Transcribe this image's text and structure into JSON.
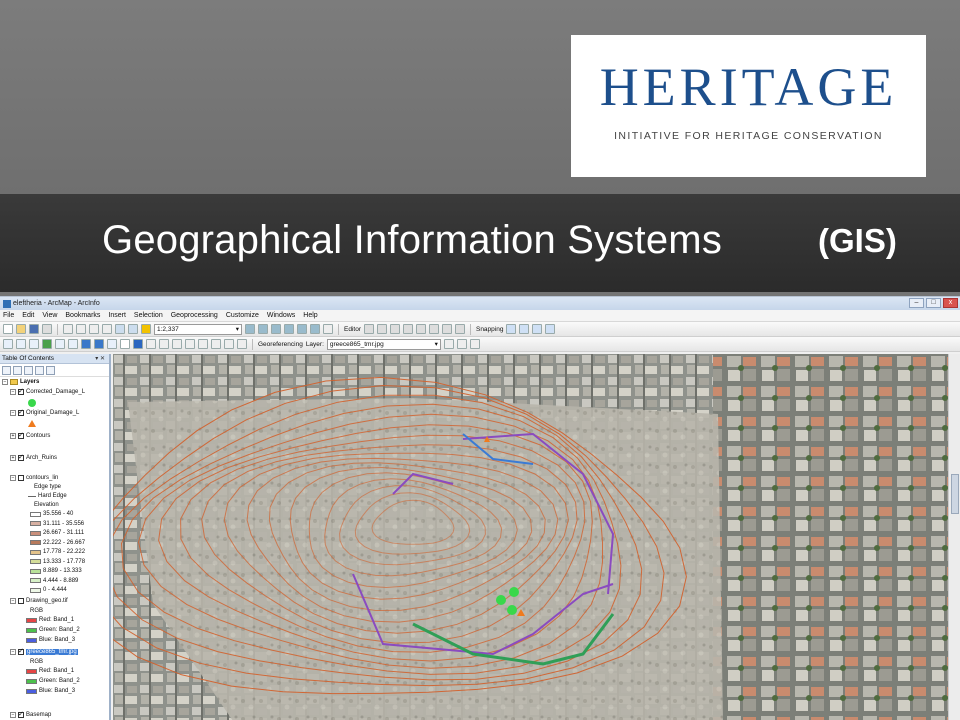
{
  "logo": {
    "wordmark": "HERITAGE",
    "tagline": "INITIATIVE FOR HERITAGE CONSERVATION",
    "color": "#1d4f8c"
  },
  "slide": {
    "title": "Geographical Information Systems",
    "title_abbr": "(GIS)"
  },
  "app": {
    "window_title": "eleftheria - ArcMap - ArcInfo",
    "menu": [
      "File",
      "Edit",
      "View",
      "Bookmarks",
      "Insert",
      "Selection",
      "Geoprocessing",
      "Customize",
      "Windows",
      "Help"
    ],
    "scale": "1:2,337",
    "editor_label": "Editor",
    "snapping_label": "Snapping",
    "georef_label": "Georeferencing",
    "layer_label": "Layer:",
    "layer_value": "greece865_tmr.jpg",
    "window_controls": [
      "–",
      "□",
      "x"
    ]
  },
  "toc": {
    "title": "Table Of Contents",
    "head_controls": "▾ ✕",
    "root": "Layers",
    "layers": [
      {
        "name": "Corrected_Damage_L",
        "checked": true
      },
      {
        "name": "Original_Damage_L",
        "checked": true
      },
      {
        "name": "Contours",
        "checked": true
      },
      {
        "name": "Arch_Ruins",
        "checked": true
      },
      {
        "name": "contours_lin",
        "checked": false
      }
    ],
    "contour_legend": {
      "edge_type": "Edge type",
      "hard_edge": "Hard Edge",
      "elevation": "Elevation",
      "classes": [
        {
          "label": "35.556 - 40",
          "color": "#ffffff"
        },
        {
          "label": "31.111 - 35.556",
          "color": "#d7b0a2"
        },
        {
          "label": "26.667 - 31.111",
          "color": "#c98f7b"
        },
        {
          "label": "22.222 - 26.667",
          "color": "#b77a5c"
        },
        {
          "label": "17.778 - 22.222",
          "color": "#e3c28a"
        },
        {
          "label": "13.333 - 17.778",
          "color": "#d4dd9a"
        },
        {
          "label": "8.889 - 13.333",
          "color": "#b9e29a"
        },
        {
          "label": "4.444 - 8.889",
          "color": "#d7f1c7"
        },
        {
          "label": "0 - 4.444",
          "color": "#eef8e7"
        }
      ]
    },
    "raster1": {
      "name": "Drawing_geo.tif",
      "checked": false
    },
    "raster2": {
      "name": "greece865_tmr.jpg",
      "checked": true
    },
    "rgb_label": "RGB",
    "bands": [
      {
        "label": "Red: Band_1",
        "color": "#e64545"
      },
      {
        "label": "Green: Band_2",
        "color": "#4cc14c"
      },
      {
        "label": "Blue: Band_3",
        "color": "#4a5ee0"
      }
    ],
    "basemap": {
      "name": "Basemap",
      "checked": true
    }
  },
  "colors": {
    "contour": "#d2622e",
    "arch_lines": "#8a4bc0",
    "damage_points": "#39d84b",
    "damage_triangles": "#ef7b1e",
    "green_walls": "#2f9f57"
  }
}
